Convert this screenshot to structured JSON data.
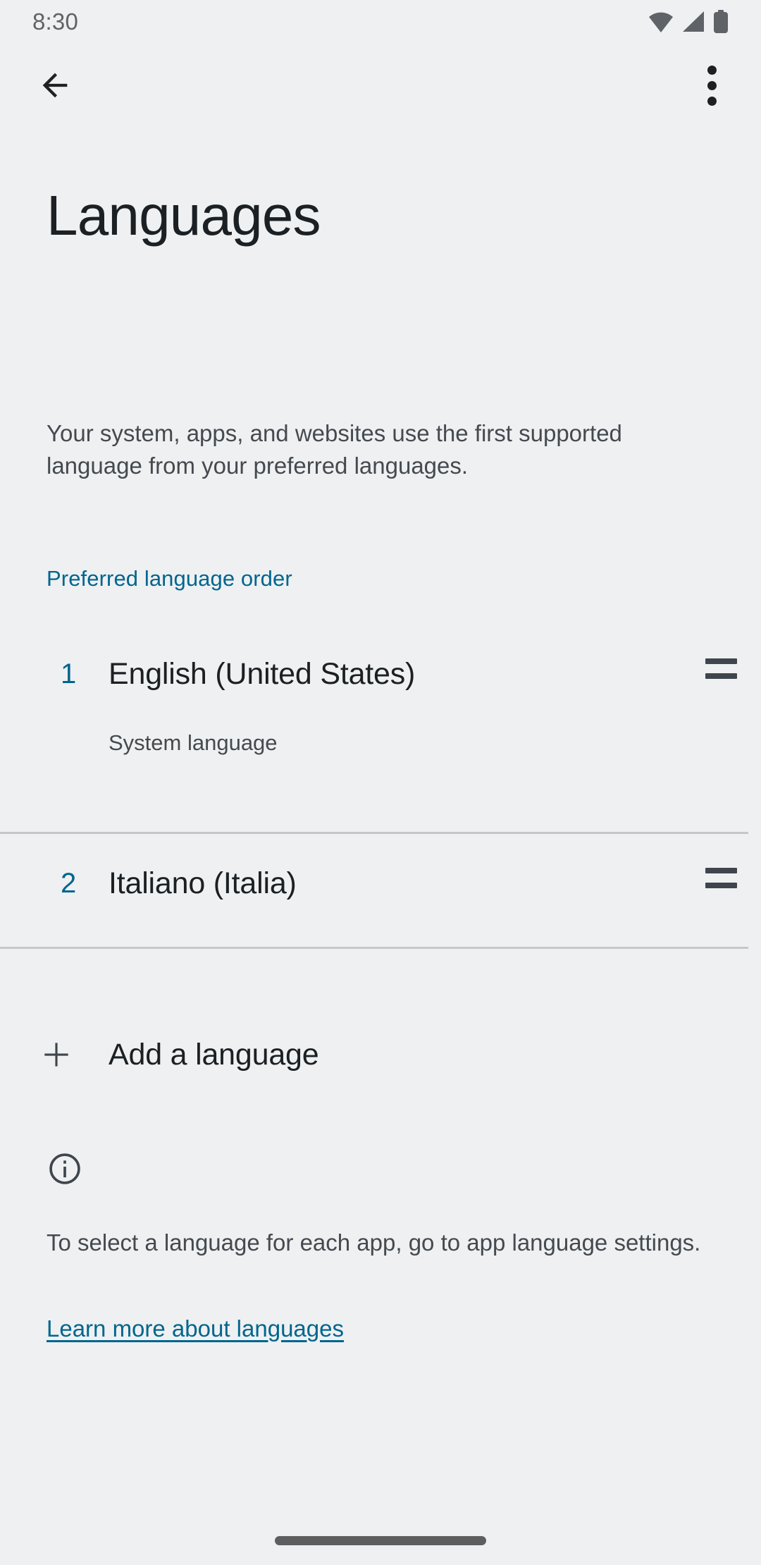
{
  "status_bar": {
    "time": "8:30",
    "icons": [
      "wifi-icon",
      "signal-icon",
      "battery-icon"
    ]
  },
  "action_bar": {
    "back_icon": "back-arrow-icon",
    "overflow_icon": "overflow-menu-icon"
  },
  "page": {
    "title": "Languages",
    "intro": "Your system, apps, and websites use the first supported language from your preferred languages."
  },
  "section": {
    "header": "Preferred language order"
  },
  "languages": [
    {
      "index": "1",
      "name": "English (United States)",
      "subtitle": "System language",
      "drag_icon": "drag-handle-icon"
    },
    {
      "index": "2",
      "name": "Italiano (Italia)",
      "subtitle": "",
      "drag_icon": "drag-handle-icon"
    }
  ],
  "add_language": {
    "label": "Add a language",
    "icon": "plus-icon"
  },
  "footer": {
    "info_icon": "info-circle-icon",
    "text": "To select a language for each app, go to app language settings.",
    "link": "Learn more about languages"
  },
  "colors": {
    "background": "#EFF0F1",
    "accent": "#00658F",
    "primary_text": "#1B2024",
    "secondary_text": "#444A4F",
    "divider": "#C6C6C8",
    "drag_handle": "#3F454C"
  }
}
